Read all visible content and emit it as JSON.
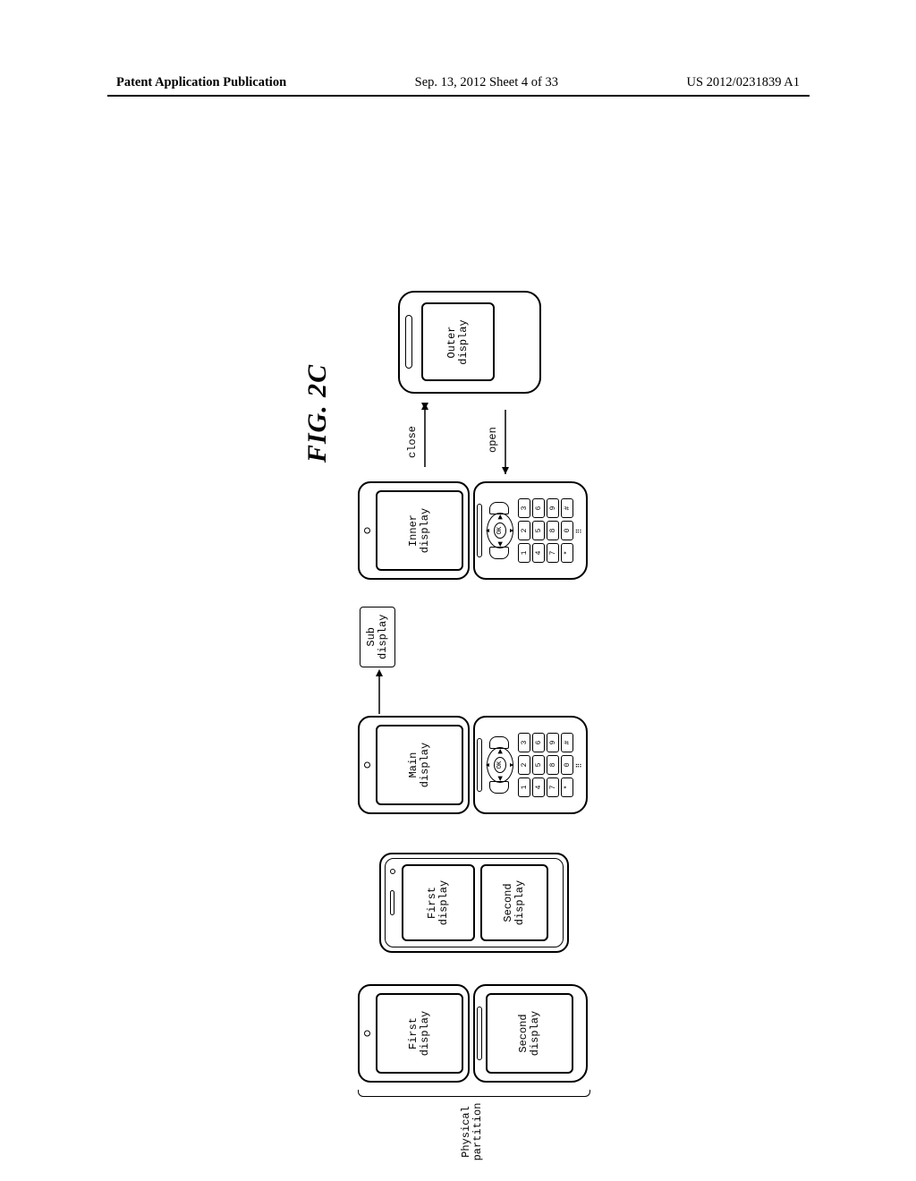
{
  "header": {
    "publication": "Patent Application Publication",
    "date_sheet": "Sep. 13, 2012  Sheet 4 of 33",
    "number": "US 2012/0231839 A1"
  },
  "figure_label": "FIG. 2C",
  "labels": {
    "physical_partition": "Physical\npartition",
    "first_display": "First\ndisplay",
    "second_display": "Second\ndisplay",
    "main_display": "Main\ndisplay",
    "sub_display": "Sub\ndisplay",
    "inner_display": "Inner\ndisplay",
    "outer_display": "Outer\ndisplay",
    "close": "close",
    "open": "open",
    "ok": "OK"
  },
  "keypad": [
    "1",
    "2",
    "3",
    "4",
    "5",
    "6",
    "7",
    "8",
    "9",
    "*",
    "0",
    "#"
  ]
}
